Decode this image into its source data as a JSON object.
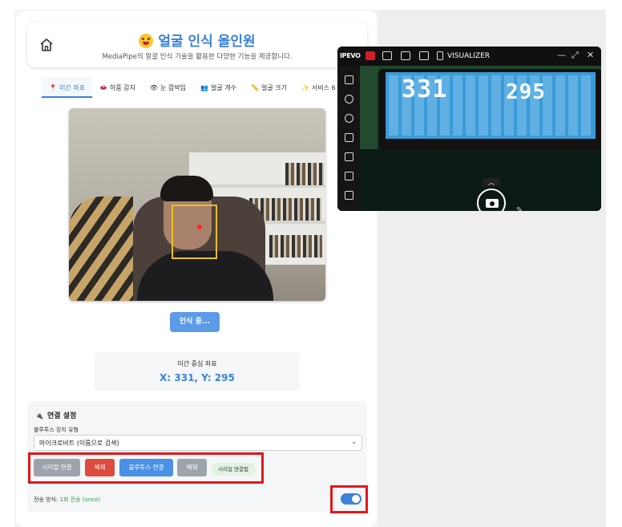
{
  "header": {
    "title": "얼굴 인식 올인원",
    "subtitle": "MediaPipe의 얼굴 인식 기술을 활용한 다양한 기능을 제공합니다."
  },
  "tabs": [
    {
      "icon": "📍",
      "label": "미간 좌표",
      "active": true
    },
    {
      "icon": "👄",
      "label": "하품 감지",
      "active": false
    },
    {
      "icon": "👁",
      "label": "눈 깜박임",
      "active": false
    },
    {
      "icon": "👥",
      "label": "얼굴 개수",
      "active": false
    },
    {
      "icon": "📏",
      "label": "얼굴 크기",
      "active": false
    },
    {
      "icon": "✨",
      "label": "서비스 6",
      "active": false
    }
  ],
  "recognize_button": "인식 중...",
  "coords": {
    "label": "미간 중심 좌표",
    "value": "X: 331, Y: 295"
  },
  "connection": {
    "title": "연결 설정",
    "bt_type_label": "블루투스 장치 유형",
    "bt_type_selected": "마이크로비트 (이름으로 검색)",
    "buttons": {
      "serial_connect": "시리얼 연결",
      "serial_disconnect": "해제",
      "bt_connect": "블루투스 연결",
      "bt_disconnect": "해제"
    },
    "status": "시리얼 연결됨",
    "send_mode_label": "전송 방식:",
    "send_mode_value": "1회 전송 (once)",
    "toggle_on": true
  },
  "visualizer": {
    "brand": "IPEVO",
    "title": "VISUALIZER",
    "lcd_x": "331",
    "lcd_y": "295"
  },
  "colors": {
    "accent": "#3b82d8",
    "danger": "#dd4b3f",
    "highlight": "#e01818",
    "status_green": "#2f9a48"
  }
}
